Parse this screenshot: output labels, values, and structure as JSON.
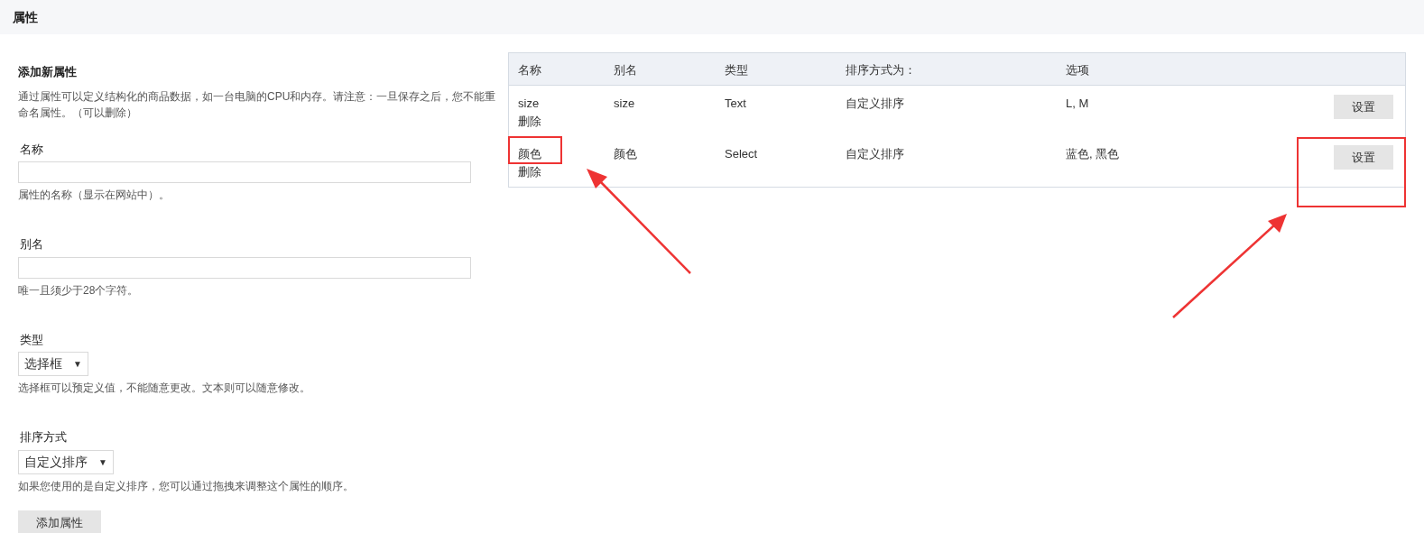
{
  "page_title": "属性",
  "form": {
    "heading": "添加新属性",
    "description": "通过属性可以定义结构化的商品数据，如一台电脑的CPU和内存。请注意：一旦保存之后，您不能重命名属性。（可以删除）",
    "fields": [
      {
        "kind": "text",
        "label": "名称",
        "help": "属性的名称（显示在网站中）。"
      },
      {
        "kind": "text",
        "label": "别名",
        "help": "唯一且须少于28个字符。"
      },
      {
        "kind": "select",
        "label": "类型",
        "value": "选择框",
        "help": "选择框可以预定义值，不能随意更改。文本则可以随意修改。"
      },
      {
        "kind": "select",
        "label": "排序方式",
        "value": "自定义排序",
        "help": "如果您使用的是自定义排序，您可以通过拖拽来调整这个属性的顺序。"
      }
    ],
    "caret": "▼",
    "button": "添加属性"
  },
  "table": {
    "columns": [
      "名称",
      "别名",
      "类型",
      "排序方式为：",
      "选项"
    ],
    "rows": [
      {
        "name": "size",
        "delete": "删除",
        "alias": "size",
        "type": "Text",
        "sort": "自定义排序",
        "options": "L, M",
        "action": "设置"
      },
      {
        "name": "颜色",
        "delete": "删除",
        "alias": "颜色",
        "type": "Select",
        "sort": "自定义排序",
        "options": "蓝色, 黑色",
        "action": "设置"
      }
    ]
  }
}
